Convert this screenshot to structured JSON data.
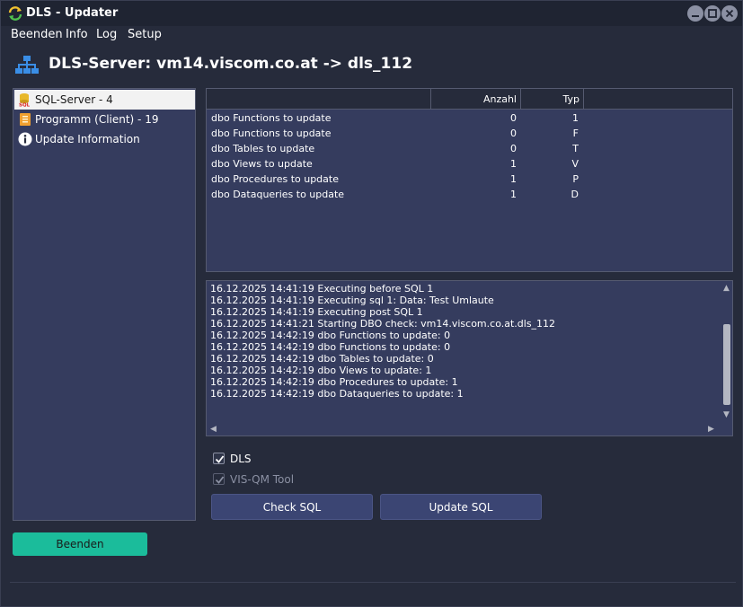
{
  "window": {
    "title": "DLS - Updater"
  },
  "menu": [
    "Beenden",
    "Info",
    "Log",
    "Setup"
  ],
  "header": {
    "title": "DLS-Server: vm14.viscom.co.at -> dls_112"
  },
  "tree": {
    "items": [
      {
        "label": "SQL-Server - 4",
        "icon": "sql-icon",
        "selected": true
      },
      {
        "label": "Programm (Client) - 19",
        "icon": "document-icon",
        "selected": false
      },
      {
        "label": "Update Information",
        "icon": "info-icon",
        "selected": false
      }
    ]
  },
  "grid": {
    "columns": [
      "",
      "Anzahl",
      "Typ"
    ],
    "rows": [
      {
        "name": "dbo Functions to update",
        "count": "0",
        "typ": "1"
      },
      {
        "name": "dbo Functions to update",
        "count": "0",
        "typ": "F"
      },
      {
        "name": "dbo Tables to update",
        "count": "0",
        "typ": "T"
      },
      {
        "name": "dbo Views to update",
        "count": "1",
        "typ": "V"
      },
      {
        "name": "dbo Procedures to update",
        "count": "1",
        "typ": "P"
      },
      {
        "name": "dbo Dataqueries to update",
        "count": "1",
        "typ": "D"
      }
    ]
  },
  "log": {
    "lines": [
      "16.12.2025 14:41:19 Executing before SQL  1",
      "16.12.2025 14:41:19 Executing sql 1: Data:  Test Umlaute",
      "16.12.2025 14:41:19 Executing post SQL  1",
      "16.12.2025 14:41:21 Starting DBO check: vm14.viscom.co.at.dls_112",
      "16.12.2025 14:42:19 dbo Functions to update: 0",
      "16.12.2025 14:42:19 dbo Functions to update: 0",
      "16.12.2025 14:42:19 dbo Tables to update: 0",
      "16.12.2025 14:42:19 dbo Views to update: 1",
      "16.12.2025 14:42:19 dbo Procedures to update: 1",
      "16.12.2025 14:42:19 dbo Dataqueries to update: 1"
    ]
  },
  "options": {
    "dls": {
      "label": "DLS",
      "checked": true,
      "enabled": true
    },
    "visqm": {
      "label": "VIS-QM Tool",
      "checked": true,
      "enabled": false
    }
  },
  "buttons": {
    "check_sql": "Check SQL",
    "update_sql": "Update SQL",
    "beenden": "Beenden"
  },
  "colors": {
    "accent": "#1bbc9b",
    "panel": "#353c5e",
    "button": "#3b4573",
    "background": "#262b3b"
  }
}
